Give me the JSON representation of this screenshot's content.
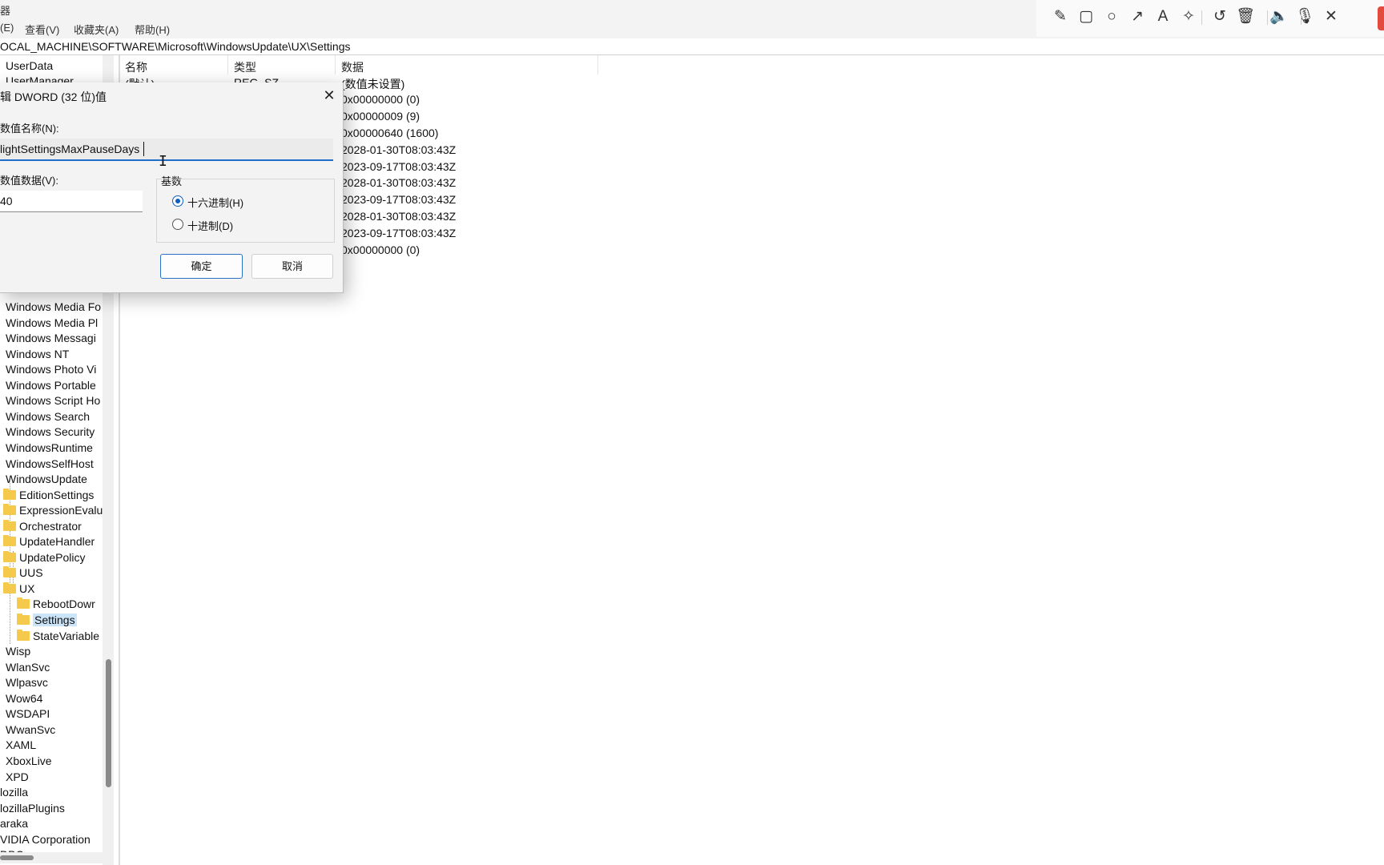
{
  "window": {
    "title_fragment": "器"
  },
  "menu": [
    "(E)",
    "查看(V)",
    "收藏夹(A)",
    "帮助(H)"
  ],
  "address": "OCAL_MACHINE\\SOFTWARE\\Microsoft\\WindowsUpdate\\UX\\Settings",
  "tree": {
    "top_items": [
      "UserData",
      "UserManager"
    ],
    "items": [
      "Windows Media Fo",
      "Windows Media Pl",
      "Windows Messagi",
      "Windows NT",
      "Windows Photo Vi",
      "Windows Portable",
      "Windows Script Ho",
      "Windows Search",
      "Windows Security",
      "WindowsRuntime",
      "WindowsSelfHost",
      "WindowsUpdate",
      "EditionSettings",
      "ExpressionEvalu",
      "Orchestrator",
      "UpdateHandler",
      "UpdatePolicy",
      "UUS",
      "UX",
      "RebootDowr",
      "Settings",
      "StateVariable",
      "Wisp",
      "WlanSvc",
      "Wlpasvc",
      "Wow64",
      "WSDAPI",
      "WwanSvc",
      "XAML",
      "XboxLive",
      "XPD",
      "lozilla",
      "lozillaPlugins",
      "araka",
      "VIDIA Corporation",
      "DBC"
    ]
  },
  "list": {
    "columns": {
      "name": "名称",
      "type": "类型",
      "data": "数据"
    },
    "partial_name": "(默认)",
    "partial_type": "REG_SZ",
    "data_rows": [
      "(数值未设置)",
      "0x00000000 (0)",
      "0x00000009 (9)",
      "0x00000640 (1600)",
      "2028-01-30T08:03:43Z",
      "2023-09-17T08:03:43Z",
      "2028-01-30T08:03:43Z",
      "2023-09-17T08:03:43Z",
      "2028-01-30T08:03:43Z",
      "2023-09-17T08:03:43Z",
      "0x00000000 (0)"
    ]
  },
  "dialog": {
    "title": "辑 DWORD (32 位)值",
    "close_glyph": "✕",
    "name_label": "数值名称(N):",
    "name_value": "lightSettingsMaxPauseDays",
    "data_label": "数值数据(V):",
    "data_value": "40",
    "base_label": "基数",
    "hex_label": "十六进制(H)",
    "dec_label": "十进制(D)",
    "selected_base": "hex",
    "ok_label": "确定",
    "cancel_label": "取消"
  },
  "annotation_toolbar": {
    "icons": [
      {
        "name": "pencil-icon",
        "glyph": "✎"
      },
      {
        "name": "rectangle-icon",
        "glyph": "▢"
      },
      {
        "name": "circle-icon",
        "glyph": "○"
      },
      {
        "name": "arrow-icon",
        "glyph": "↗"
      },
      {
        "name": "text-icon",
        "glyph": "A"
      },
      {
        "name": "magic-wand-icon",
        "glyph": "✧"
      },
      {
        "name": "undo-icon",
        "glyph": "↺"
      },
      {
        "name": "trash-icon",
        "glyph": "🗑"
      },
      {
        "name": "speaker-icon",
        "glyph": "🔈"
      },
      {
        "name": "microphone-icon",
        "glyph": "🎙"
      },
      {
        "name": "close-icon",
        "glyph": "✕"
      }
    ],
    "accent": "#e34b3f"
  },
  "colors": {
    "selection": "#cce4f7",
    "focus": "#1f6fc9",
    "folder": "#f5c94c"
  }
}
